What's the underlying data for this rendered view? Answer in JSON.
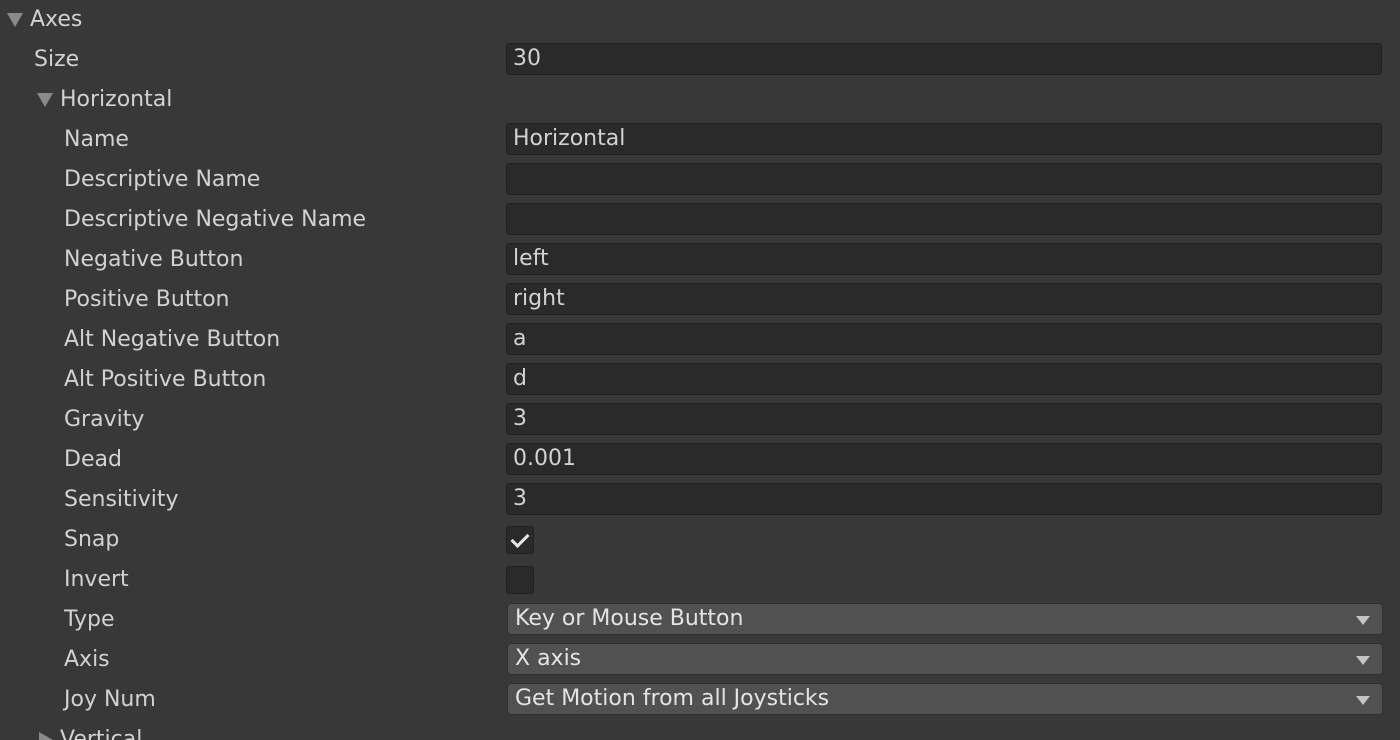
{
  "axes": {
    "label": "Axes",
    "size_label": "Size",
    "size_value": "30"
  },
  "horizontal": {
    "label": "Horizontal",
    "name_label": "Name",
    "name_value": "Horizontal",
    "descriptive_name_label": "Descriptive Name",
    "descriptive_name_value": "",
    "descriptive_negative_name_label": "Descriptive Negative Name",
    "descriptive_negative_name_value": "",
    "negative_button_label": "Negative Button",
    "negative_button_value": "left",
    "positive_button_label": "Positive Button",
    "positive_button_value": "right",
    "alt_negative_button_label": "Alt Negative Button",
    "alt_negative_button_value": "a",
    "alt_positive_button_label": "Alt Positive Button",
    "alt_positive_button_value": "d",
    "gravity_label": "Gravity",
    "gravity_value": "3",
    "dead_label": "Dead",
    "dead_value": "0.001",
    "sensitivity_label": "Sensitivity",
    "sensitivity_value": "3",
    "snap_label": "Snap",
    "snap_checked": true,
    "invert_label": "Invert",
    "invert_checked": false,
    "type_label": "Type",
    "type_value": "Key or Mouse Button",
    "axis_label": "Axis",
    "axis_value": "X axis",
    "joy_num_label": "Joy Num",
    "joy_num_value": "Get Motion from all Joysticks"
  },
  "vertical": {
    "label": "Vertical"
  },
  "icons": {
    "expanded": "triangle-down-icon",
    "collapsed": "triangle-right-icon",
    "dropdown": "chevron-down-icon",
    "check": "checkmark-icon"
  },
  "colors": {
    "background": "#383838",
    "field_background": "#2a2a2a",
    "dropdown_background": "#515151",
    "text": "#d2d2d2"
  }
}
